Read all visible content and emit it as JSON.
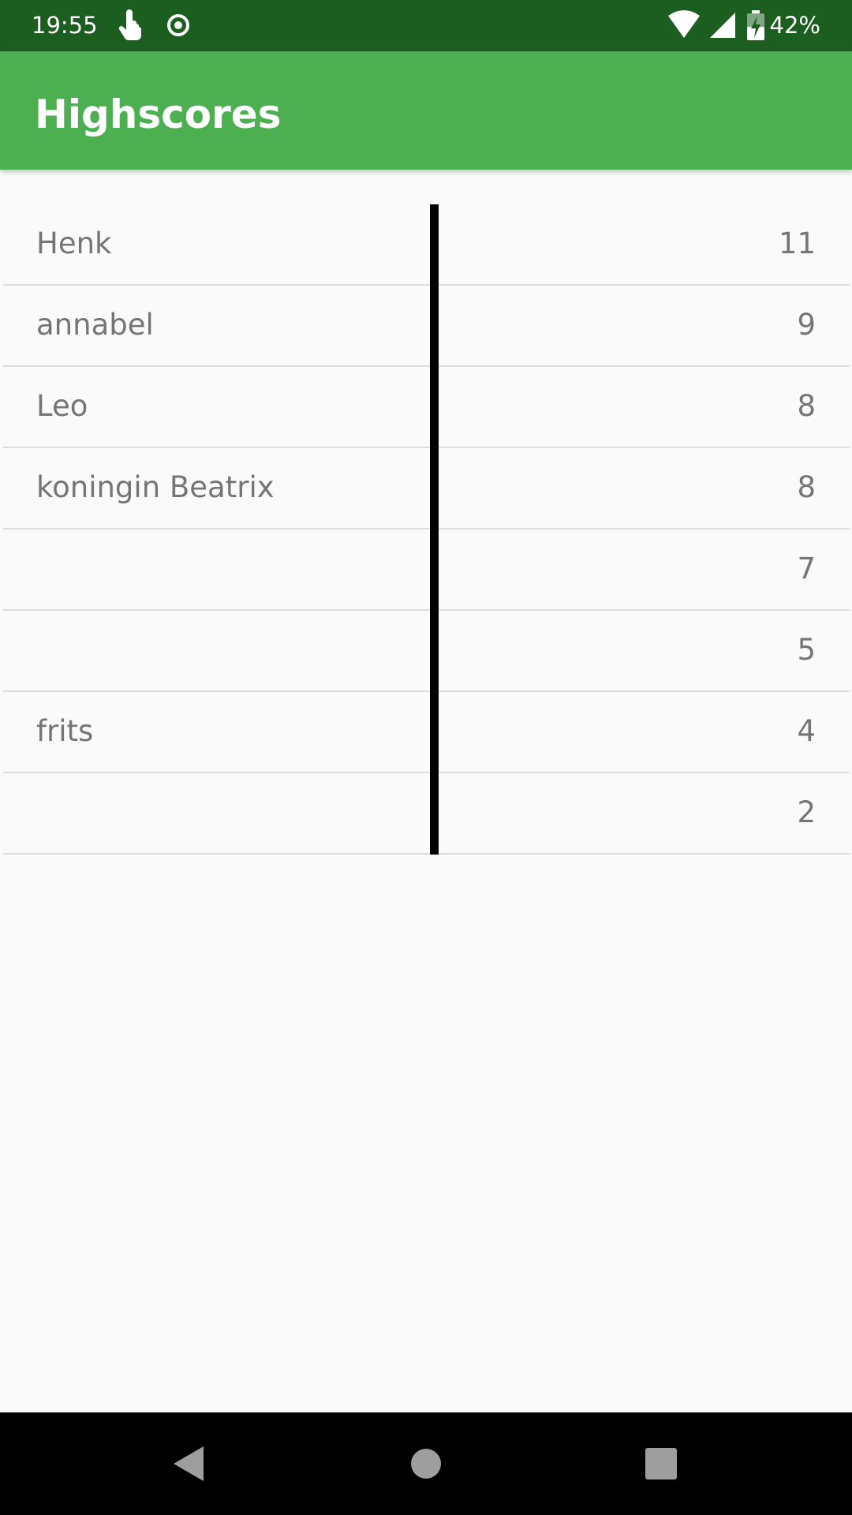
{
  "status_bar": {
    "time": "19:55",
    "battery_percent": "42%",
    "icons": [
      "touch-icon",
      "record-icon",
      "wifi-icon",
      "signal-icon",
      "battery-charging-icon"
    ]
  },
  "app_bar": {
    "title": "Highscores"
  },
  "scores": [
    {
      "name": "Henk",
      "score": "11"
    },
    {
      "name": "annabel",
      "score": "9"
    },
    {
      "name": "Leo",
      "score": "8"
    },
    {
      "name": "koningin Beatrix",
      "score": "8"
    },
    {
      "name": "",
      "score": "7"
    },
    {
      "name": "",
      "score": "5"
    },
    {
      "name": "frits",
      "score": "4"
    },
    {
      "name": "",
      "score": "2"
    }
  ],
  "nav_bar": {
    "icons": [
      "back-icon",
      "home-icon",
      "recents-icon"
    ]
  },
  "colors": {
    "status_bar": "#1b5e20",
    "app_bar": "#4caf50",
    "background": "#fafafa",
    "text": "#757575",
    "divider": "#000000"
  }
}
